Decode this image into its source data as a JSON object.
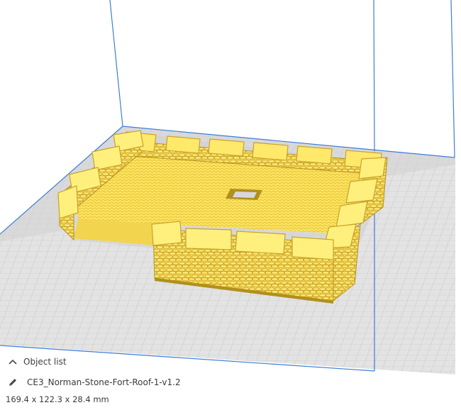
{
  "viewport": {
    "bed_color": "#e3e3e3",
    "grid_color": "#cfcfcf",
    "build_volume_line_color": "#3b7ed8",
    "model_color": "#ffe45c",
    "model_shadow_color": "#c9a62a"
  },
  "object_panel": {
    "toggle_icon": "chevron-up-icon",
    "title": "Object list",
    "edit_icon": "pencil-icon",
    "object_name": "CE3_Norman-Stone-Fort-Roof-1-v1.2",
    "dimensions": "169.4 x 122.3 x 28.4 mm"
  }
}
